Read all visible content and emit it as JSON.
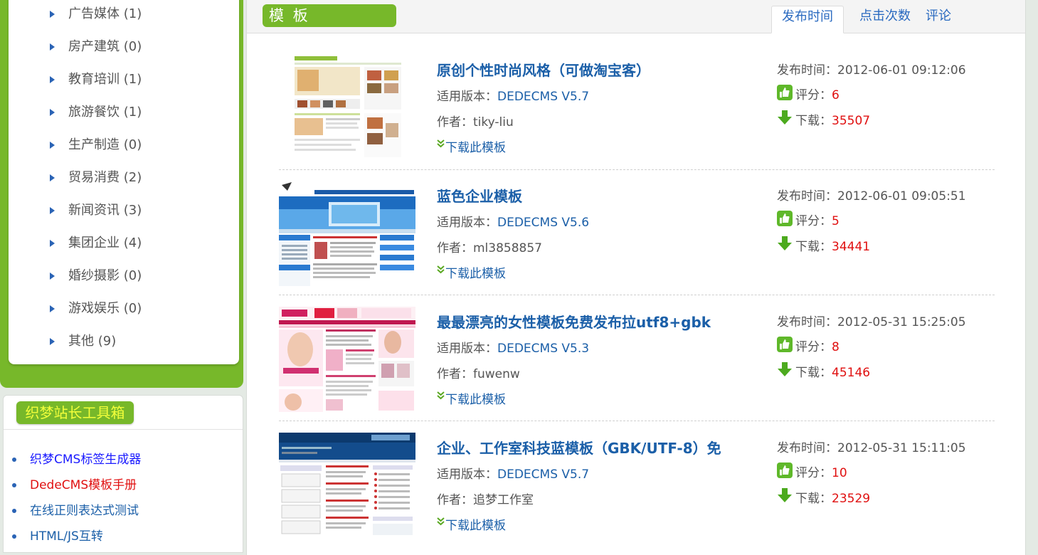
{
  "sidebar": {
    "categories": [
      {
        "label": "广告媒体 (1)"
      },
      {
        "label": "房产建筑 (0)"
      },
      {
        "label": "教育培训 (1)"
      },
      {
        "label": "旅游餐饮 (1)"
      },
      {
        "label": "生产制造 (0)"
      },
      {
        "label": "贸易消费 (2)"
      },
      {
        "label": "新闻资讯 (3)"
      },
      {
        "label": "集团企业 (4)"
      },
      {
        "label": "婚纱摄影 (0)"
      },
      {
        "label": "游戏娱乐 (0)"
      },
      {
        "label": "其他 (9)"
      }
    ],
    "tools_title": "织梦站长工具箱",
    "tools": [
      {
        "label": "织梦CMS标签生成器",
        "color": "#1a1aff"
      },
      {
        "label": "DedeCMS模板手册",
        "color": "#e01010"
      },
      {
        "label": "在线正则表达式测试",
        "color": "#1b5fa8"
      },
      {
        "label": "HTML/JS互转",
        "color": "#1b5fa8"
      }
    ]
  },
  "main": {
    "section_title": "模 板",
    "sort_tabs": [
      {
        "label": "发布时间",
        "active": true
      },
      {
        "label": "点击次数",
        "active": false
      },
      {
        "label": "评论",
        "active": false
      }
    ],
    "labels": {
      "version": "适用版本：",
      "author": "作者：",
      "download_link": "下载此模板",
      "pub_time": "发布时间：",
      "rating": "评分：",
      "downloads": "下载："
    },
    "templates": [
      {
        "title": "原创个性时尚风格（可做淘宝客）",
        "version": "DEDECMS V5.7",
        "author": "tiky-liu",
        "pub_time": "2012-06-01 09:12:06",
        "rating": "6",
        "downloads": "35507",
        "thumb": "fashion"
      },
      {
        "title": "蓝色企业模板",
        "version": "DEDECMS V5.6",
        "author": "ml3858857",
        "pub_time": "2012-06-01 09:05:51",
        "rating": "5",
        "downloads": "34441",
        "thumb": "blue"
      },
      {
        "title": "最最漂亮的女性模板免费发布拉utf8+gbk",
        "version": "DEDECMS V5.3",
        "author": "fuwenw",
        "pub_time": "2012-05-31 15:25:05",
        "rating": "8",
        "downloads": "45146",
        "thumb": "pink"
      },
      {
        "title": "企业、工作室科技蓝模板（GBK/UTF-8）免",
        "version": "DEDECMS V5.7",
        "author": "追梦工作室",
        "pub_time": "2012-05-31 15:11:05",
        "rating": "10",
        "downloads": "23529",
        "thumb": "studio"
      }
    ]
  },
  "colors": {
    "brand_green": "#77b82a",
    "link_blue": "#1b5fa8",
    "number_red": "#e01010",
    "tools_title_text": "#f3ff3b"
  },
  "icons": {
    "category_bullet": "triangle-right-icon",
    "rating": "thumbs-up-icon",
    "download": "arrow-down-icon",
    "download_link": "double-chevron-down-icon"
  }
}
